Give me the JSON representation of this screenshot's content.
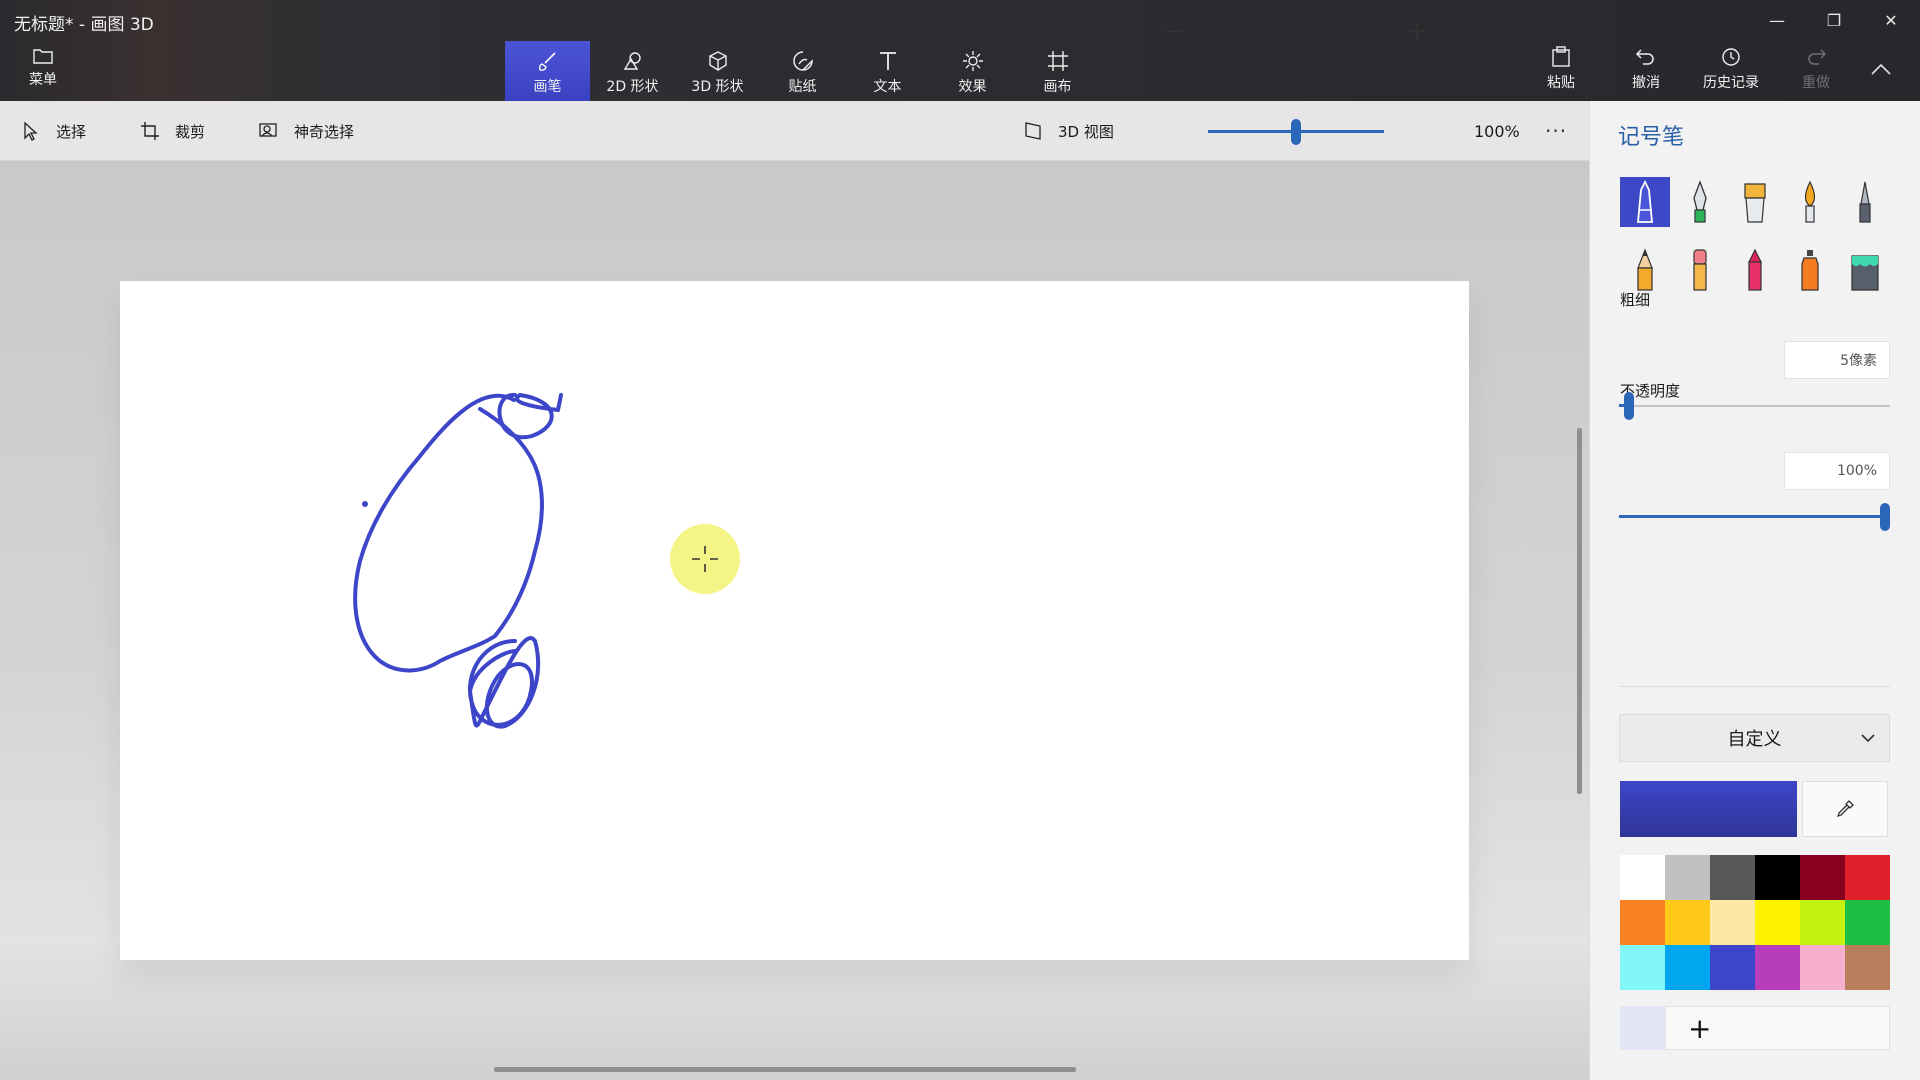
{
  "window": {
    "title": "无标题* - 画图 3D",
    "minimize": "—",
    "maximize": "❐",
    "close": "✕"
  },
  "menu": {
    "label": "菜单"
  },
  "tabs": [
    {
      "label": "画笔",
      "icon": "brush-icon",
      "active": true
    },
    {
      "label": "2D 形状",
      "icon": "2d-shapes-icon"
    },
    {
      "label": "3D 形状",
      "icon": "3d-shapes-icon"
    },
    {
      "label": "贴纸",
      "icon": "sticker-icon"
    },
    {
      "label": "文本",
      "icon": "text-icon"
    },
    {
      "label": "效果",
      "icon": "effects-icon"
    },
    {
      "label": "画布",
      "icon": "canvas-icon"
    }
  ],
  "right_tools": {
    "paste": "粘贴",
    "undo": "撤消",
    "history": "历史记录",
    "redo": "重做"
  },
  "subtoolbar": {
    "select": "选择",
    "crop": "裁剪",
    "magic_select": "神奇选择",
    "view_3d": "3D 视图",
    "zoom_minus": "—",
    "zoom_plus": "+",
    "zoom_value": "100%",
    "zoom_level": 0.5,
    "more": "···"
  },
  "panel": {
    "title": "记号笔",
    "brushes": [
      {
        "name": "marker",
        "selected": true
      },
      {
        "name": "calligraphy-pen"
      },
      {
        "name": "oil-brush"
      },
      {
        "name": "watercolor"
      },
      {
        "name": "pixel-pen"
      },
      {
        "name": "pencil"
      },
      {
        "name": "eraser"
      },
      {
        "name": "crayon"
      },
      {
        "name": "spray-can"
      },
      {
        "name": "fill"
      }
    ],
    "thickness_label": "粗细",
    "thickness_value": "5像素",
    "thickness_level": 0.02,
    "opacity_label": "不透明度",
    "opacity_value": "100%",
    "opacity_level": 1.0,
    "color_mode": "自定义",
    "current_color": "#3d46c8",
    "palette": [
      "#ffffff",
      "#c1c1c1",
      "#585858",
      "#000000",
      "#870020",
      "#e0202a",
      "#fb8123",
      "#ffc919",
      "#fde9a4",
      "#fff300",
      "#c3f210",
      "#1ebf42",
      "#83f7f7",
      "#00a7ef",
      "#3d46c8",
      "#b83dbc",
      "#f6b0cd",
      "#b97e5c"
    ],
    "add_color_label": "+"
  }
}
